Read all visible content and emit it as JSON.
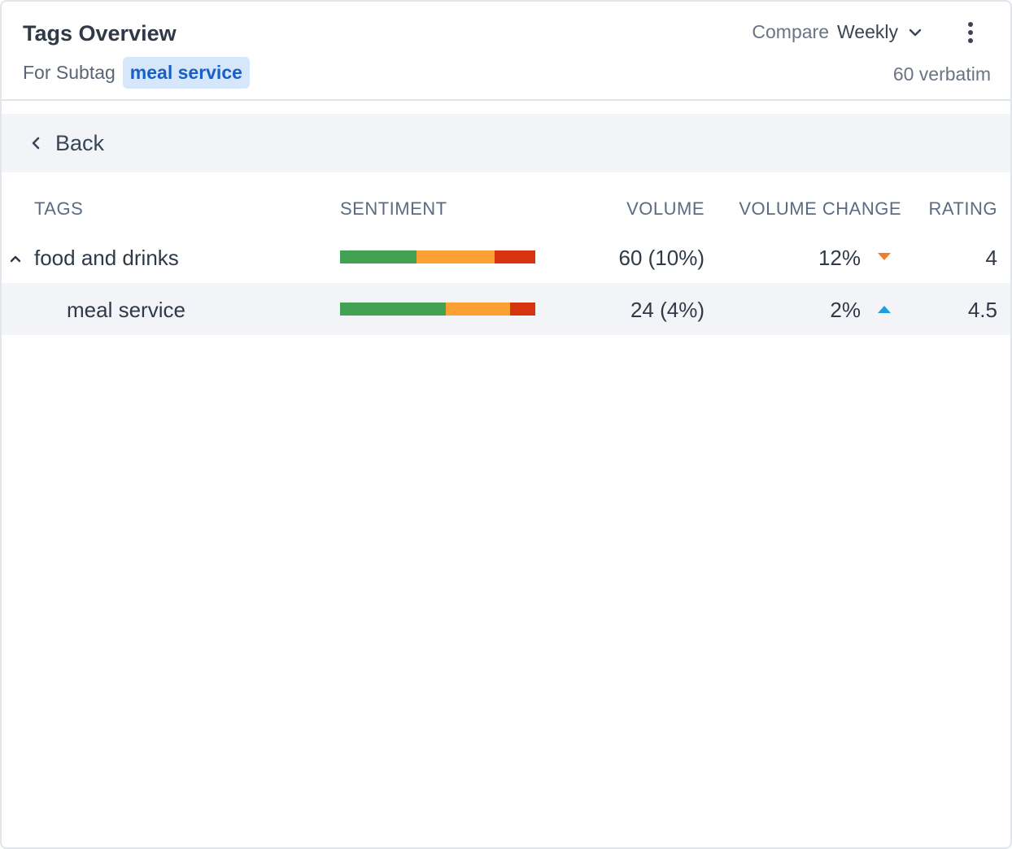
{
  "header": {
    "title": "Tags Overview",
    "subtag_label": "For Subtag",
    "subtag_chip": "meal service",
    "compare_label": "Compare",
    "compare_value": "Weekly",
    "verbatim_count": "60 verbatim"
  },
  "back": {
    "label": "Back"
  },
  "table": {
    "columns": [
      "TAGS",
      "SENTIMENT",
      "VOLUME",
      "VOLUME CHANGE",
      "RATING"
    ],
    "rows": [
      {
        "tag": "food and drinks",
        "sentiment": {
          "positive": 0.39,
          "neutral": 0.4,
          "negative": 0.21
        },
        "volume": "60 (10%)",
        "volume_change": "12%",
        "change_direction": "down",
        "rating": "4"
      },
      {
        "tag": "meal service",
        "sentiment": {
          "positive": 0.54,
          "neutral": 0.33,
          "negative": 0.13
        },
        "volume": "24 (4%)",
        "volume_change": "2%",
        "change_direction": "up",
        "rating": "4.5"
      }
    ]
  },
  "colors": {
    "positive": "#43a153",
    "neutral": "#fba133",
    "negative": "#d5340f",
    "trend_down": "#f07d2c",
    "trend_up": "#1aa0dc",
    "chip_bg": "#d6e6fb",
    "chip_text": "#1a5fc4"
  },
  "icons": {
    "compare_dropdown": "chevron-down-icon",
    "menu": "kebab-menu-icon",
    "back": "chevron-left-icon",
    "expand": "chevron-up-icon"
  }
}
